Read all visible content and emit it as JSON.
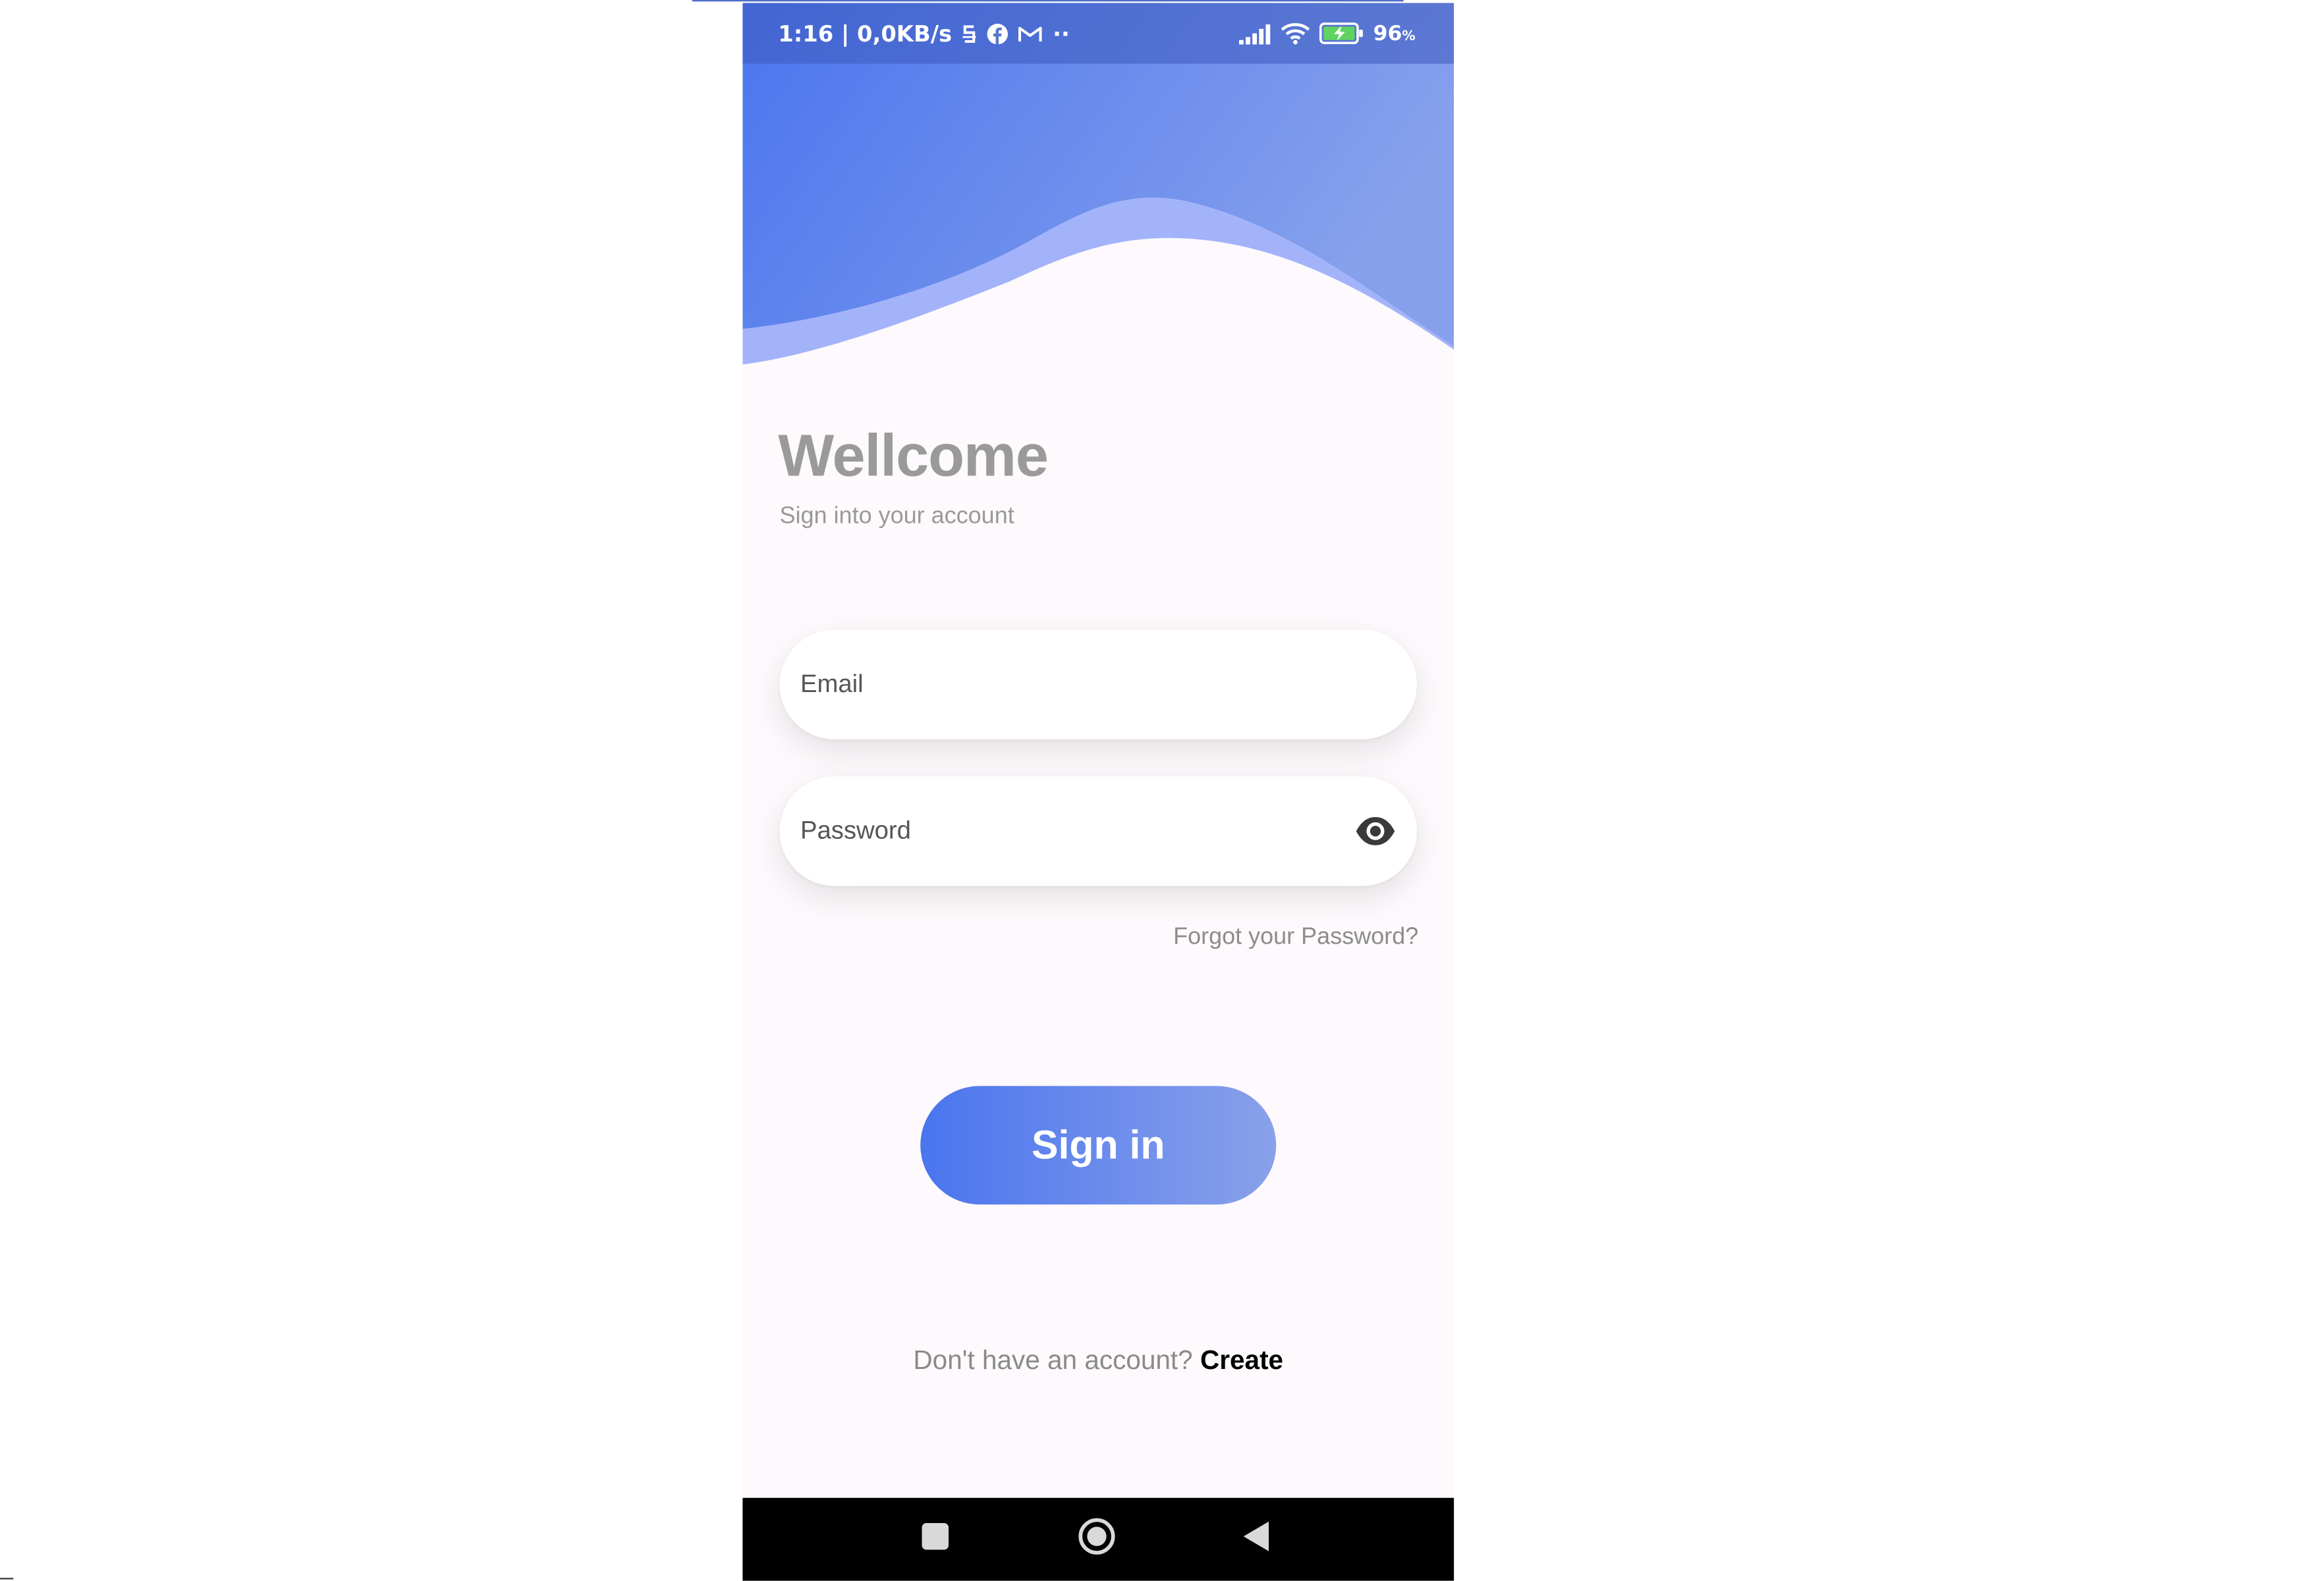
{
  "status_bar": {
    "time_speed": "1:16 | 0,0KB/s",
    "more_dots": "··",
    "battery_percent": "96",
    "battery_unit": "%"
  },
  "icons": {
    "status_left": [
      "s-app-icon",
      "facebook-icon",
      "gmail-icon",
      "more-icon"
    ],
    "status_right": [
      "signal-icon",
      "wifi-icon",
      "battery-charging-icon"
    ],
    "password_toggle": "eye-icon",
    "nav": [
      "recents-icon",
      "home-icon",
      "back-icon"
    ]
  },
  "colors": {
    "header_gradient_start": "#4a75ee",
    "header_gradient_end": "#86a0ec",
    "wave_band": "#a3b3fa",
    "page_bg": "#fdf9fc",
    "button_gradient_start": "#4a75ee",
    "button_gradient_end": "#8aa1ea",
    "battery_green": "#5fd35f"
  },
  "welcome": {
    "title": "Wellcome",
    "subtitle": "Sign into your account"
  },
  "form": {
    "email": {
      "placeholder": "Email",
      "value": ""
    },
    "password": {
      "placeholder": "Password",
      "value": ""
    },
    "forgot_label": "Forgot your Password?",
    "signin_label": "Sign in"
  },
  "signup": {
    "prompt": "Don't have an account?",
    "link_label": "Create"
  }
}
